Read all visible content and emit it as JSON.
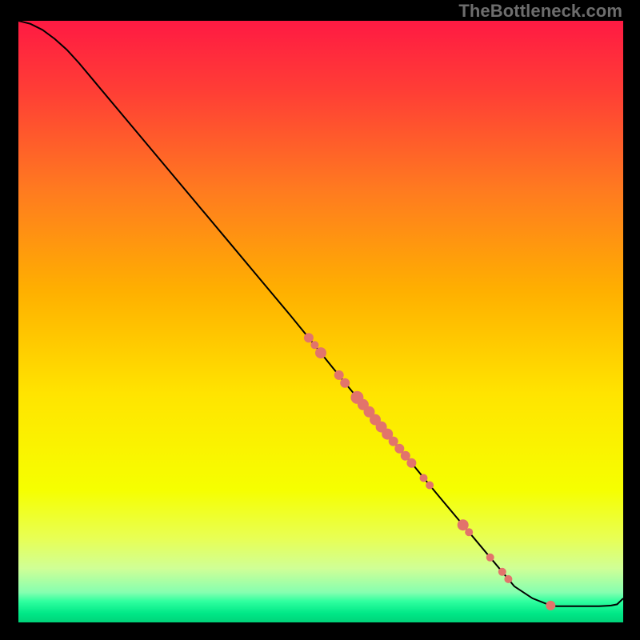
{
  "watermark": "TheBottleneck.com",
  "chart_data": {
    "type": "line",
    "title": "",
    "xlabel": "",
    "ylabel": "",
    "xlim": [
      0,
      100
    ],
    "ylim": [
      0,
      100
    ],
    "grid": false,
    "legend": false,
    "background_gradient": {
      "stops": [
        {
          "offset": 0.0,
          "color": "#ff1a43"
        },
        {
          "offset": 0.12,
          "color": "#ff3f35"
        },
        {
          "offset": 0.28,
          "color": "#ff7a20"
        },
        {
          "offset": 0.45,
          "color": "#ffb000"
        },
        {
          "offset": 0.62,
          "color": "#ffe400"
        },
        {
          "offset": 0.78,
          "color": "#f6ff00"
        },
        {
          "offset": 0.86,
          "color": "#e8ff54"
        },
        {
          "offset": 0.91,
          "color": "#d0ff96"
        },
        {
          "offset": 0.95,
          "color": "#86ffb0"
        },
        {
          "offset": 0.965,
          "color": "#2fff9f"
        },
        {
          "offset": 0.985,
          "color": "#00e887"
        },
        {
          "offset": 1.0,
          "color": "#00d379"
        }
      ]
    },
    "series": [
      {
        "name": "bottleneck-curve",
        "x": [
          0.0,
          2.0,
          4.0,
          6.0,
          8.0,
          10.0,
          12.5,
          15.0,
          20.0,
          25.0,
          30.0,
          35.0,
          40.0,
          45.0,
          48.0,
          50.0,
          52.0,
          55.0,
          58.0,
          60.0,
          62.0,
          65.0,
          68.0,
          70.0,
          72.0,
          75.0,
          78.0,
          80.0,
          82.0,
          85.0,
          88.0,
          89.0,
          90.0,
          92.0,
          94.0,
          96.0,
          98.0,
          99.0,
          99.5,
          100.0
        ],
        "y": [
          100.0,
          99.5,
          98.5,
          97.0,
          95.2,
          93.0,
          90.0,
          87.0,
          81.0,
          75.0,
          69.0,
          63.0,
          57.0,
          51.0,
          47.3,
          44.8,
          42.3,
          38.6,
          35.0,
          32.5,
          30.1,
          26.5,
          22.8,
          20.4,
          18.0,
          14.4,
          10.8,
          8.4,
          6.0,
          4.0,
          2.8,
          2.7,
          2.7,
          2.7,
          2.7,
          2.7,
          2.8,
          3.0,
          3.5,
          4.0
        ]
      }
    ],
    "markers": {
      "name": "highlighted-points",
      "color": "#e2746b",
      "points": [
        {
          "x": 48.0,
          "y": 47.3,
          "r": 6
        },
        {
          "x": 49.0,
          "y": 46.1,
          "r": 5
        },
        {
          "x": 50.0,
          "y": 44.8,
          "r": 7
        },
        {
          "x": 53.0,
          "y": 41.1,
          "r": 6
        },
        {
          "x": 54.0,
          "y": 39.8,
          "r": 6
        },
        {
          "x": 56.0,
          "y": 37.4,
          "r": 8
        },
        {
          "x": 57.0,
          "y": 36.2,
          "r": 7
        },
        {
          "x": 58.0,
          "y": 35.0,
          "r": 7
        },
        {
          "x": 59.0,
          "y": 33.7,
          "r": 7
        },
        {
          "x": 60.0,
          "y": 32.5,
          "r": 7
        },
        {
          "x": 61.0,
          "y": 31.3,
          "r": 7
        },
        {
          "x": 62.0,
          "y": 30.1,
          "r": 6
        },
        {
          "x": 63.0,
          "y": 28.9,
          "r": 6
        },
        {
          "x": 64.0,
          "y": 27.7,
          "r": 6
        },
        {
          "x": 65.0,
          "y": 26.5,
          "r": 6
        },
        {
          "x": 67.0,
          "y": 24.0,
          "r": 5
        },
        {
          "x": 68.0,
          "y": 22.8,
          "r": 5
        },
        {
          "x": 73.5,
          "y": 16.2,
          "r": 7
        },
        {
          "x": 74.5,
          "y": 15.0,
          "r": 5
        },
        {
          "x": 78.0,
          "y": 10.8,
          "r": 5
        },
        {
          "x": 80.0,
          "y": 8.4,
          "r": 5
        },
        {
          "x": 81.0,
          "y": 7.2,
          "r": 5
        },
        {
          "x": 88.0,
          "y": 2.8,
          "r": 6
        }
      ]
    }
  }
}
